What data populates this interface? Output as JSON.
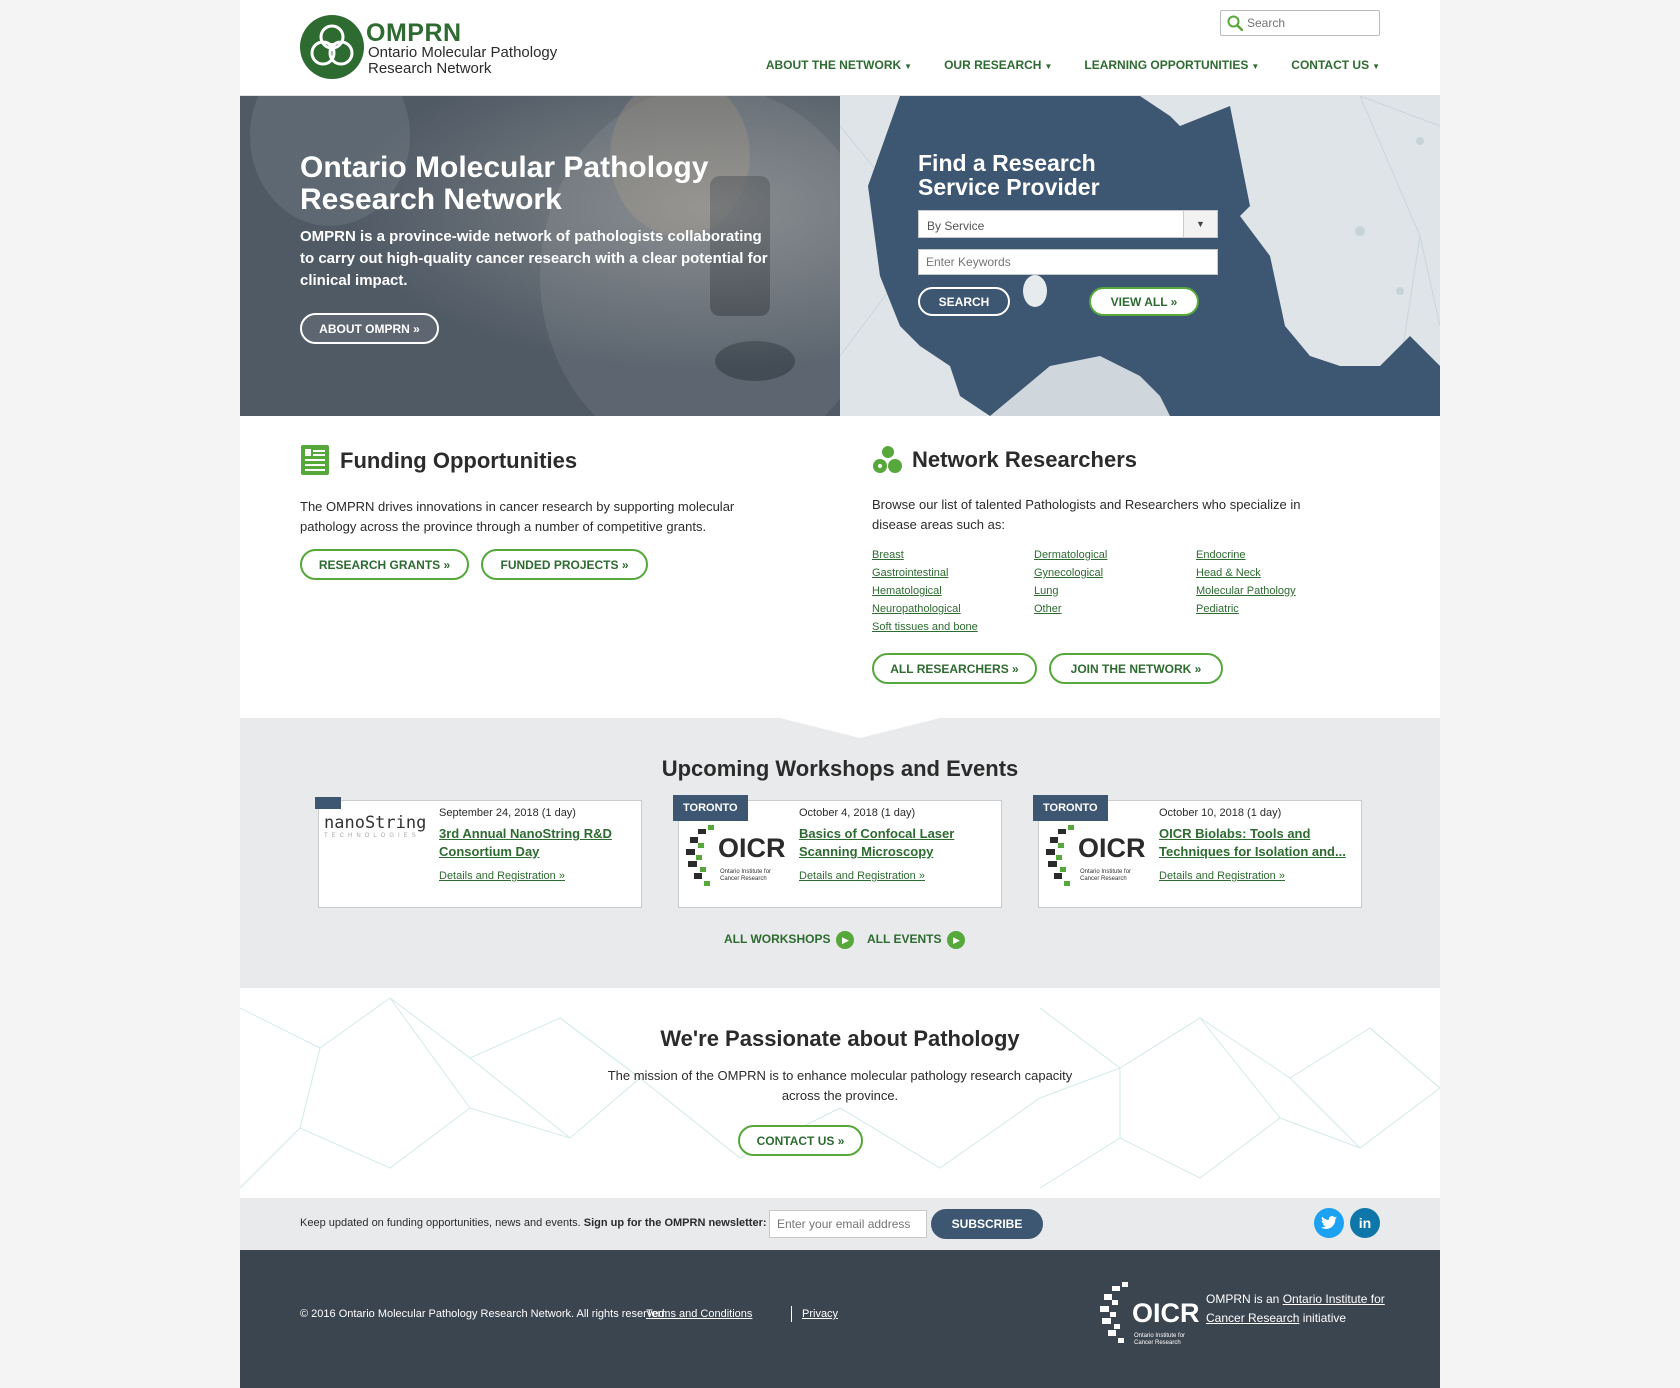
{
  "header": {
    "logo": {
      "abbr": "OMPRN",
      "line1": "Ontario Molecular Pathology",
      "line2": "Research Network"
    },
    "search_placeholder": "Search",
    "nav": [
      "ABOUT THE NETWORK",
      "OUR RESEARCH",
      "LEARNING OPPORTUNITIES",
      "CONTACT US"
    ]
  },
  "hero": {
    "title": "Ontario Molecular Pathology Research Network",
    "text": "OMPRN is a province-wide network of pathologists collaborating to carry out high-quality cancer research with a clear potential for clinical impact.",
    "button": "ABOUT OMPRN »"
  },
  "finder": {
    "title": "Find a Research Service Provider",
    "select_value": "By Service",
    "keywords_placeholder": "Enter Keywords",
    "search_button": "SEARCH",
    "view_all_button": "VIEW ALL »"
  },
  "funding": {
    "title": "Funding Opportunities",
    "text": "The OMPRN drives innovations in cancer research by supporting molecular pathology across the province through a number of competitive grants.",
    "buttons": [
      "RESEARCH GRANTS »",
      "FUNDED PROJECTS »"
    ]
  },
  "researchers": {
    "title": "Network Researchers",
    "text": "Browse our list of talented Pathologists and Researchers who specialize in disease areas such as:",
    "areas": [
      "Breast",
      "Dermatological",
      "Endocrine",
      "Gastrointestinal",
      "Gynecological",
      "Head & Neck",
      "Hematological",
      "Lung",
      "Molecular Pathology",
      "Neuropathological",
      "Other",
      "Pediatric",
      "Soft tissues and bone"
    ],
    "buttons": [
      "ALL RESEARCHERS »",
      "JOIN THE NETWORK »"
    ]
  },
  "events": {
    "title": "Upcoming Workshops and Events",
    "cards": [
      {
        "tag": "",
        "logo": "nanoString",
        "logo_sub": "TECHNOLOGIES",
        "date": "September 24, 2018 (1 day)",
        "title": "3rd Annual NanoString R&D Consortium Day",
        "details": "Details and Registration »"
      },
      {
        "tag": "TORONTO",
        "logo": "OICR",
        "logo_sub": "Ontario Institute for Cancer Research",
        "date": "October 4, 2018 (1 day)",
        "title": "Basics of Confocal Laser Scanning Microscopy",
        "details": "Details and Registration »"
      },
      {
        "tag": "TORONTO",
        "logo": "OICR",
        "logo_sub": "Ontario Institute for Cancer Research",
        "date": "October 10, 2018 (1 day)",
        "title": "OICR Biolabs: Tools and Techniques for Isolation and...",
        "details": "Details and Registration »"
      }
    ],
    "links": [
      "ALL WORKSHOPS",
      "ALL EVENTS"
    ]
  },
  "mission": {
    "title": "We're Passionate about Pathology",
    "text": "The mission of the OMPRN is to enhance molecular pathology research capacity across the province.",
    "button": "CONTACT US »"
  },
  "newsletter": {
    "text": "Keep updated on funding opportunities, news and events.",
    "bold": "Sign up for the OMPRN newsletter:",
    "email_placeholder": "Enter your email address",
    "button": "SUBSCRIBE",
    "social": [
      "twitter",
      "linkedin"
    ]
  },
  "footer": {
    "copyright": "© 2016 Ontario Molecular Pathology Research Network. All rights reserved.",
    "links": [
      "Terms and Conditions",
      "Privacy"
    ],
    "oicr_logo": "OICR",
    "oicr_sub": "Ontario Institute for Cancer Research",
    "initiative_pre": "OMPRN is an",
    "initiative_link": "Ontario Institute for Cancer Research",
    "initiative_post": "initiative"
  },
  "colors": {
    "green": "#2e6b31",
    "button_green": "#56a83b",
    "navy": "#3d5671",
    "footer": "#3b454f",
    "twitter": "#1da1f2",
    "linkedin": "#0e76a8"
  }
}
